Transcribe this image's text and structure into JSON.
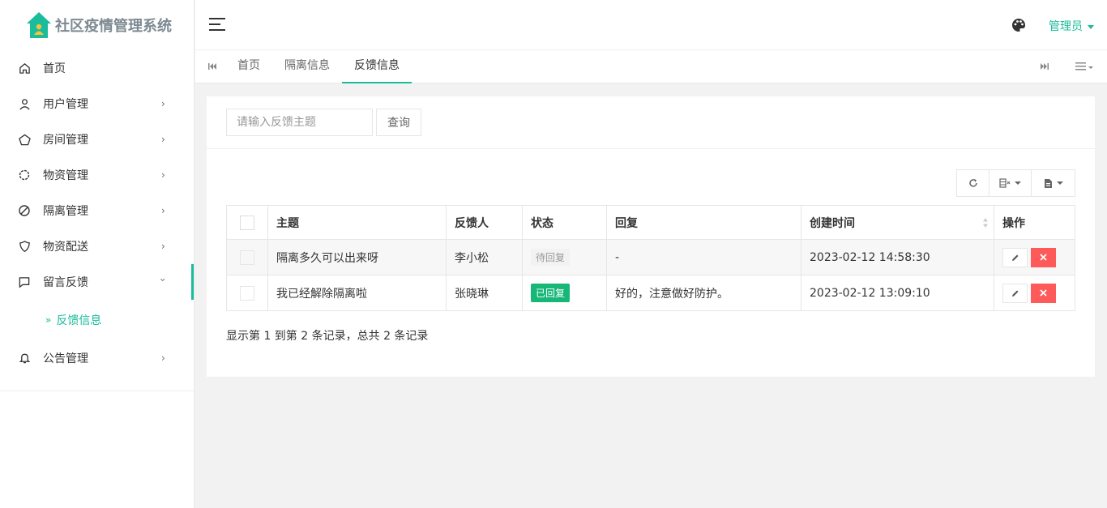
{
  "app": {
    "title": "社区疫情管理系统",
    "accent_color": "#1bbc9b"
  },
  "header": {
    "user_label": "管理员",
    "icons": [
      "menu-icon",
      "palette-icon"
    ]
  },
  "sidebar": {
    "items": [
      {
        "label": "首页",
        "icon": "home-icon"
      },
      {
        "label": "用户管理",
        "icon": "user-icon"
      },
      {
        "label": "房间管理",
        "icon": "pentagon-icon"
      },
      {
        "label": "物资管理",
        "icon": "gear-icon"
      },
      {
        "label": "隔离管理",
        "icon": "ban-icon"
      },
      {
        "label": "物资配送",
        "icon": "shield-icon"
      },
      {
        "label": "留言反馈",
        "icon": "message-icon"
      },
      {
        "label": "公告管理",
        "icon": "bell-icon"
      }
    ],
    "submenu": {
      "label": "反馈信息"
    }
  },
  "tabs": [
    {
      "label": "首页"
    },
    {
      "label": "隔离信息"
    },
    {
      "label": "反馈信息"
    }
  ],
  "search": {
    "placeholder": "请输入反馈主题",
    "button_label": "查询"
  },
  "table": {
    "headers": {
      "subject": "主题",
      "person": "反馈人",
      "status": "状态",
      "reply": "回复",
      "created": "创建时间",
      "actions": "操作"
    },
    "rows": [
      {
        "subject": "隔离多久可以出来呀",
        "person": "李小松",
        "status": "待回复",
        "reply": "-",
        "created": "2023-02-12 14:58:30"
      },
      {
        "subject": "我已经解除隔离啦",
        "person": "张晓琳",
        "status": "已回复",
        "reply": "好的，注意做好防护。",
        "created": "2023-02-12 13:09:10"
      }
    ]
  },
  "pager": {
    "info": "显示第 1 到第 2 条记录，总共 2 条记录"
  },
  "colors": {
    "status_done": "#16b777",
    "delete": "#ff5a5a"
  }
}
